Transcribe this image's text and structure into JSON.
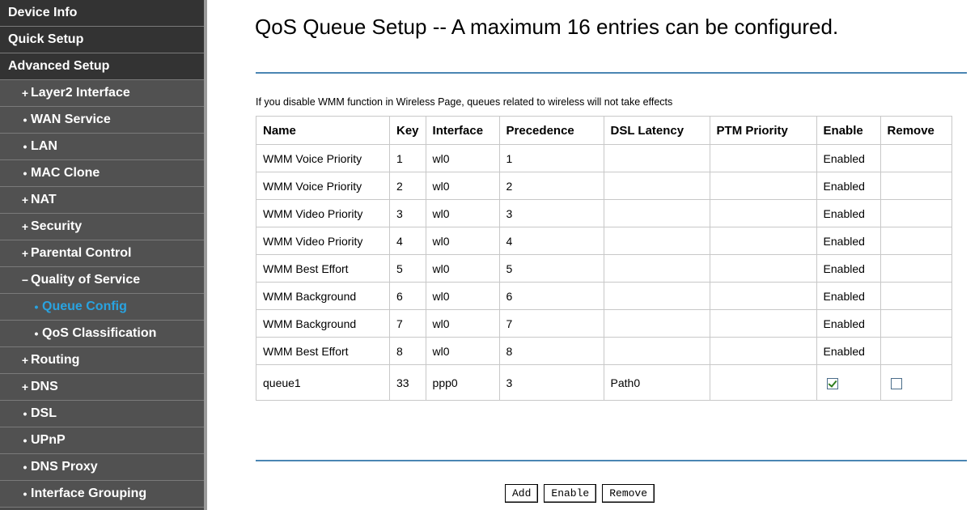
{
  "sidebar": {
    "items": [
      {
        "label": "Device Info",
        "level": "top",
        "bullet": ""
      },
      {
        "label": "Quick Setup",
        "level": "top",
        "bullet": ""
      },
      {
        "label": "Advanced Setup",
        "level": "top",
        "bullet": ""
      },
      {
        "label": "Layer2 Interface",
        "level": "l1",
        "bullet": "+"
      },
      {
        "label": "WAN Service",
        "level": "l1",
        "bullet": "•"
      },
      {
        "label": "LAN",
        "level": "l1",
        "bullet": "•"
      },
      {
        "label": "MAC Clone",
        "level": "l1",
        "bullet": "•"
      },
      {
        "label": "NAT",
        "level": "l1",
        "bullet": "+"
      },
      {
        "label": "Security",
        "level": "l1",
        "bullet": "+"
      },
      {
        "label": "Parental Control",
        "level": "l1",
        "bullet": "+"
      },
      {
        "label": "Quality of Service",
        "level": "l1",
        "bullet": "−"
      },
      {
        "label": "Queue Config",
        "level": "l2",
        "bullet": "•",
        "active": true
      },
      {
        "label": "QoS Classification",
        "level": "l2",
        "bullet": "•"
      },
      {
        "label": "Routing",
        "level": "l1",
        "bullet": "+"
      },
      {
        "label": "DNS",
        "level": "l1",
        "bullet": "+"
      },
      {
        "label": "DSL",
        "level": "l1",
        "bullet": "•"
      },
      {
        "label": "UPnP",
        "level": "l1",
        "bullet": "•"
      },
      {
        "label": "DNS Proxy",
        "level": "l1",
        "bullet": "•"
      },
      {
        "label": "Interface Grouping",
        "level": "l1",
        "bullet": "•"
      }
    ],
    "active_color": "#29a3e0"
  },
  "main": {
    "title": "QoS Queue Setup -- A maximum 16 entries can be configured.",
    "note": "If you disable WMM function in Wireless Page, queues related to wireless will not take effects",
    "table": {
      "headers": [
        "Name",
        "Key",
        "Interface",
        "Precedence",
        "DSL Latency",
        "PTM Priority",
        "Enable",
        "Remove"
      ],
      "rows": [
        {
          "name": "WMM Voice Priority",
          "key": "1",
          "interface": "wl0",
          "precedence": "1",
          "dsl_latency": "",
          "ptm_priority": "",
          "enable": "Enabled",
          "remove": ""
        },
        {
          "name": "WMM Voice Priority",
          "key": "2",
          "interface": "wl0",
          "precedence": "2",
          "dsl_latency": "",
          "ptm_priority": "",
          "enable": "Enabled",
          "remove": ""
        },
        {
          "name": "WMM Video Priority",
          "key": "3",
          "interface": "wl0",
          "precedence": "3",
          "dsl_latency": "",
          "ptm_priority": "",
          "enable": "Enabled",
          "remove": ""
        },
        {
          "name": "WMM Video Priority",
          "key": "4",
          "interface": "wl0",
          "precedence": "4",
          "dsl_latency": "",
          "ptm_priority": "",
          "enable": "Enabled",
          "remove": ""
        },
        {
          "name": "WMM Best Effort",
          "key": "5",
          "interface": "wl0",
          "precedence": "5",
          "dsl_latency": "",
          "ptm_priority": "",
          "enable": "Enabled",
          "remove": ""
        },
        {
          "name": "WMM Background",
          "key": "6",
          "interface": "wl0",
          "precedence": "6",
          "dsl_latency": "",
          "ptm_priority": "",
          "enable": "Enabled",
          "remove": ""
        },
        {
          "name": "WMM Background",
          "key": "7",
          "interface": "wl0",
          "precedence": "7",
          "dsl_latency": "",
          "ptm_priority": "",
          "enable": "Enabled",
          "remove": ""
        },
        {
          "name": "WMM Best Effort",
          "key": "8",
          "interface": "wl0",
          "precedence": "8",
          "dsl_latency": "",
          "ptm_priority": "",
          "enable": "Enabled",
          "remove": ""
        }
      ],
      "editable_row": {
        "name": "queue1",
        "key": "33",
        "interface": "ppp0",
        "precedence": "3",
        "dsl_latency": "Path0",
        "ptm_priority": "",
        "enable_checked": true,
        "remove_checked": false
      }
    },
    "buttons": {
      "add": "Add",
      "enable": "Enable",
      "remove": "Remove"
    }
  },
  "colors": {
    "sidebar_bg": "#4a4a4a",
    "divider": "#4a85b3",
    "active_link": "#29a3e0"
  }
}
